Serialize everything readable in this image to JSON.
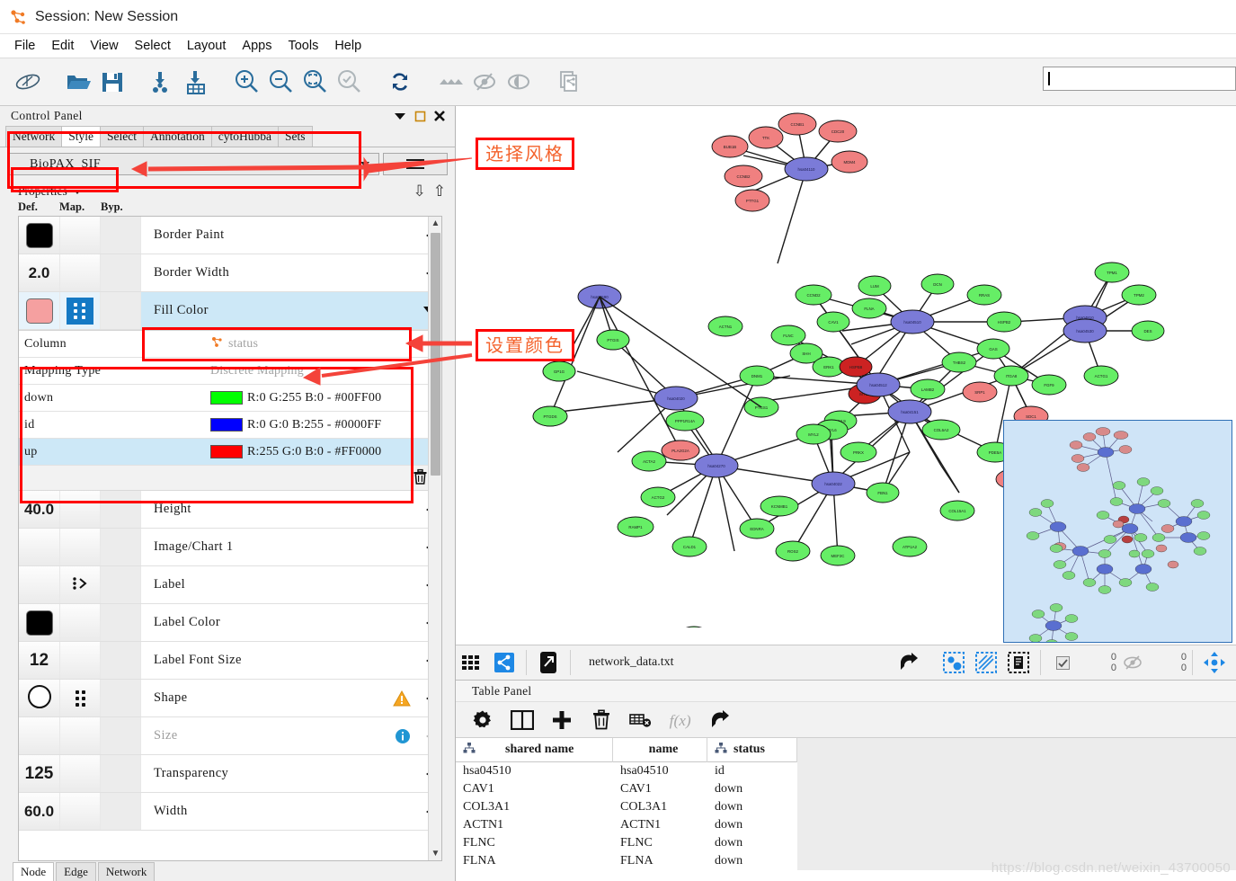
{
  "window": {
    "title": "Session: New Session",
    "logo_icon": "cytoscape-logo-icon"
  },
  "menubar": {
    "items": [
      "File",
      "Edit",
      "View",
      "Select",
      "Layout",
      "Apps",
      "Tools",
      "Help"
    ]
  },
  "toolbar": {
    "icons": [
      "cytoscape-network-icon",
      "open-folder-icon",
      "save-icon",
      "import-network-icon",
      "import-table-icon",
      "zoom-in-icon",
      "zoom-out-icon",
      "zoom-fit-icon",
      "zoom-selected-icon",
      "refresh-icon",
      "hide-selected-icon",
      "show-all-icon",
      "show-hidden-icon",
      "export-image-icon"
    ],
    "search_value": "",
    "search_placeholder": ""
  },
  "control_panel": {
    "header": "Control Panel",
    "header_buttons": [
      "dropdown-caret-icon",
      "maximize-icon",
      "close-icon"
    ],
    "tabs": [
      {
        "label": "Network",
        "active": false
      },
      {
        "label": "Style",
        "active": true
      },
      {
        "label": "Select",
        "active": false
      },
      {
        "label": "Annotation",
        "active": false
      },
      {
        "label": "cytoHubba",
        "active": false
      },
      {
        "label": "Sets",
        "active": false
      }
    ],
    "style_selector": {
      "value": "BioPAX_SIF",
      "dropdown_icon": "chevron-down-icon",
      "options_menu_icon": "hamburger-menu-icon"
    },
    "properties": {
      "title": "Properties",
      "expand_all_icon": "double-chevron-down-icon",
      "collapse_all_icon": "double-chevron-up-icon",
      "column_headers": [
        "Def.",
        "Map.",
        "Byp."
      ]
    },
    "rows_top": [
      {
        "name": "Border Paint",
        "def_type": "swatch",
        "def_color": "#000000",
        "map_type": "none",
        "selected": false
      },
      {
        "name": "Border Width",
        "def_type": "number",
        "def_value": "2.0",
        "map_type": "none",
        "selected": false
      },
      {
        "name": "Fill Color",
        "def_type": "swatch",
        "def_color": "#f5a0a0",
        "map_type": "discrete-blue",
        "selected": true,
        "expanded": true
      }
    ],
    "mapping": {
      "rows": [
        {
          "key": "Column",
          "value": "status",
          "dim": true,
          "icon": "cytoscape-column-icon"
        },
        {
          "key": "Mapping Type",
          "value": "Discrete Mapping",
          "dim": true
        },
        {
          "key": "down",
          "value": "R:0 G:255 B:0 - #00FF00",
          "color": "#00ff00",
          "selected": false
        },
        {
          "key": "id",
          "value": "R:0 G:0 B:255 - #0000FF",
          "color": "#0000ff",
          "selected": false
        },
        {
          "key": "up",
          "value": "R:255 G:0 B:0 - #FF0000",
          "color": "#ff0000",
          "selected": true
        }
      ],
      "delete_icon": "trash-icon"
    },
    "rows_bottom": [
      {
        "name": "Height",
        "def_type": "number",
        "def_value": "40.0",
        "map_type": "none"
      },
      {
        "name": "Image/Chart 1",
        "def_type": "empty",
        "map_type": "none"
      },
      {
        "name": "Label",
        "def_type": "empty",
        "map_type": "passthrough"
      },
      {
        "name": "Label Color",
        "def_type": "swatch",
        "def_color": "#000000",
        "map_type": "none"
      },
      {
        "name": "Label Font Size",
        "def_type": "number",
        "def_value": "12",
        "map_type": "none"
      },
      {
        "name": "Shape",
        "def_type": "circle",
        "map_type": "discrete-dots",
        "warning": true
      },
      {
        "name": "Size",
        "def_type": "empty",
        "map_type": "none",
        "dim": true,
        "info": true
      },
      {
        "name": "Transparency",
        "def_type": "number",
        "def_value": "125",
        "map_type": "none"
      },
      {
        "name": "Width",
        "def_type": "number",
        "def_value": "60.0",
        "map_type": "none"
      }
    ],
    "bottom_tabs": [
      {
        "label": "Node",
        "active": true
      },
      {
        "label": "Edge",
        "active": false
      },
      {
        "label": "Network",
        "active": false
      }
    ]
  },
  "network_view": {
    "status_bar": {
      "grid_icon": "grid-view-icon",
      "share_icon": "network-share-icon",
      "export_icon": "open-external-icon",
      "filename": "network_data.txt",
      "export_table_icon": "export-arrow-icon",
      "select_nodes_icon": "select-nodes-icon",
      "select_edges_icon": "select-edges-icon",
      "select_annotations_icon": "select-annotations-icon",
      "checkbox_icon": "checkbox-checked-icon",
      "hidden_icon": "hidden-eye-icon",
      "counts_left": [
        "0",
        "0"
      ],
      "counts_right": [
        "0",
        "0"
      ],
      "center_icon": "fit-center-icon"
    },
    "navigator": {
      "label": "network-navigator-minimap"
    },
    "legend_colors": {
      "up_node": "#f08080",
      "down_node": "#66ee66",
      "pathway_node": "#7b7bd8",
      "highlight_node": "#cc2222"
    }
  },
  "table_panel": {
    "title": "Table Panel",
    "toolbar_icons": [
      "settings-gear-icon",
      "columns-icon",
      "add-row-icon",
      "delete-icon",
      "clear-selection-icon",
      "function-icon",
      "export-table-icon"
    ],
    "columns": [
      {
        "label": "shared name",
        "icon": "shared-column-icon"
      },
      {
        "label": "name",
        "icon": null
      },
      {
        "label": "status",
        "icon": "shared-column-icon"
      },
      {
        "label": "",
        "icon": null
      }
    ],
    "rows": [
      [
        "hsa04510",
        "hsa04510",
        "id"
      ],
      [
        "CAV1",
        "CAV1",
        "down"
      ],
      [
        "COL3A1",
        "COL3A1",
        "down"
      ],
      [
        "ACTN1",
        "ACTN1",
        "down"
      ],
      [
        "FLNC",
        "FLNC",
        "down"
      ],
      [
        "FLNA",
        "FLNA",
        "down"
      ]
    ]
  },
  "annotations": {
    "select_style_label": "选择风格",
    "set_color_label": "设置颜色",
    "accent_color": "#ff0000",
    "text_color": "#f4622c"
  },
  "watermark": "https://blog.csdn.net/weixin_43700050"
}
